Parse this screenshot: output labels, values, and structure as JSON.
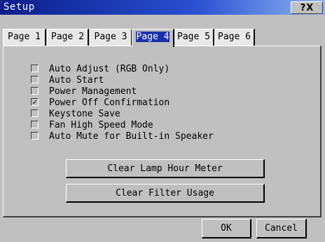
{
  "window": {
    "title": "Setup",
    "help_glyph": "?",
    "close_glyph": "X"
  },
  "tabs": [
    {
      "label": "Page 1",
      "active": false
    },
    {
      "label": "Page 2",
      "active": false
    },
    {
      "label": "Page 3",
      "active": false
    },
    {
      "label": "Page 4",
      "active": true
    },
    {
      "label": "Page 5",
      "active": false
    },
    {
      "label": "Page 6",
      "active": false
    }
  ],
  "options": [
    {
      "label": "Auto Adjust (RGB Only)",
      "checked": false
    },
    {
      "label": "Auto Start",
      "checked": false
    },
    {
      "label": "Power Management",
      "checked": false
    },
    {
      "label": "Power Off Confirmation",
      "checked": true
    },
    {
      "label": "Keystone Save",
      "checked": false
    },
    {
      "label": "Fan High Speed Mode",
      "checked": false
    },
    {
      "label": "Auto Mute for Built-in Speaker",
      "checked": false
    }
  ],
  "buttons": {
    "clear_lamp": "Clear Lamp Hour Meter",
    "clear_filter": "Clear Filter Usage",
    "ok": "OK",
    "cancel": "Cancel"
  },
  "colors": {
    "titlebar_start": "#0a1e8c",
    "titlebar_end": "#8fb6f2",
    "face": "#c0c0c0",
    "selected_tab_text_bg": "#1a2fa8"
  }
}
